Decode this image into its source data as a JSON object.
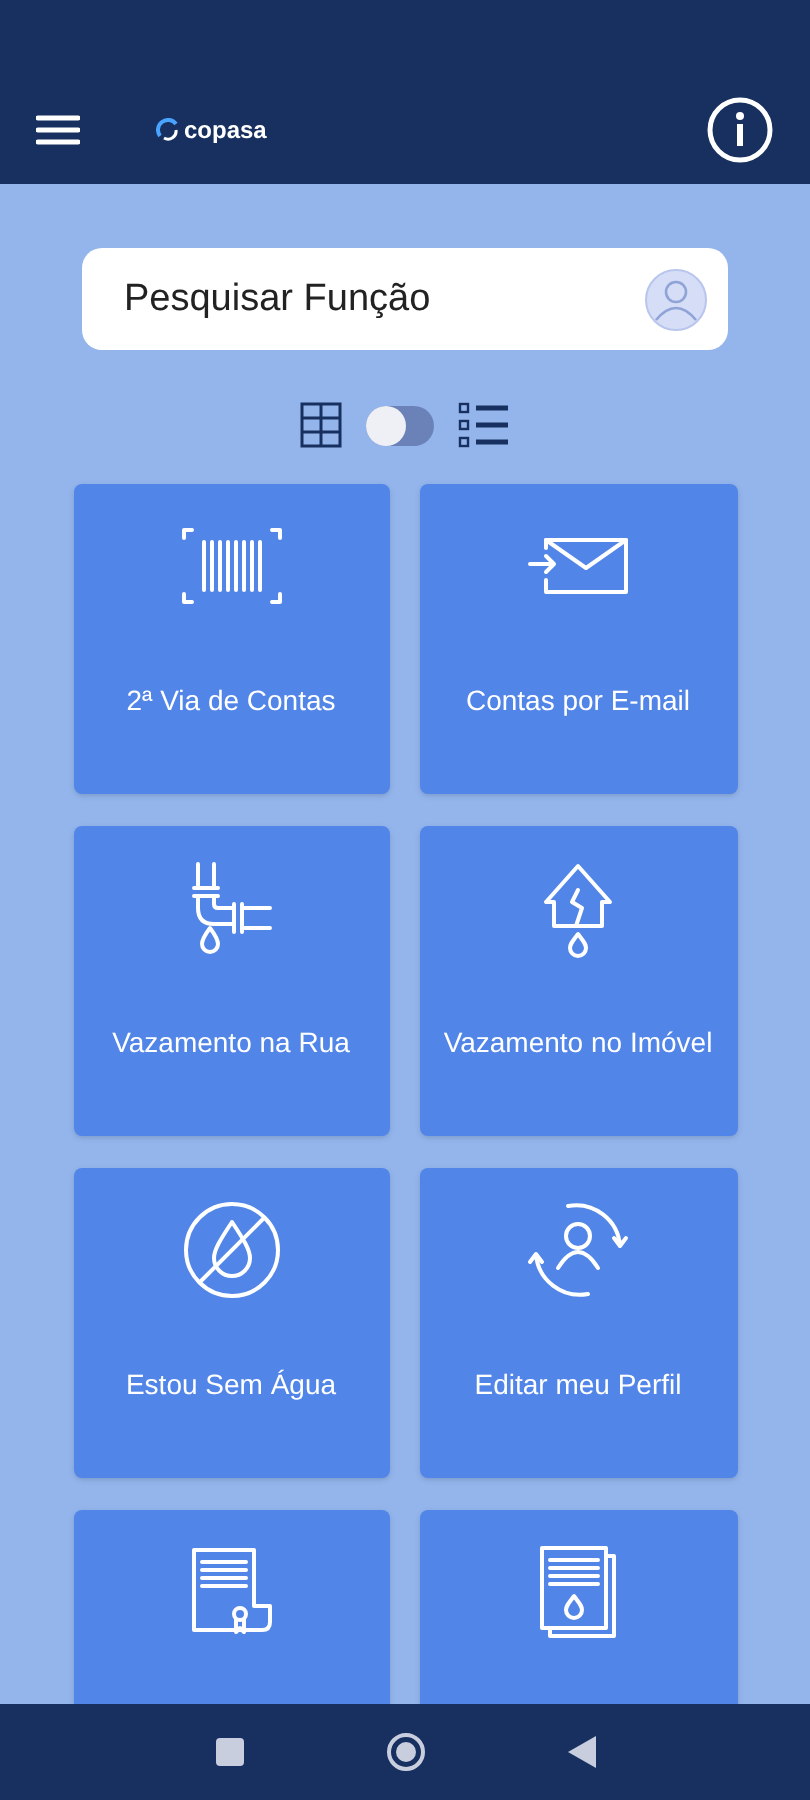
{
  "header": {
    "logo": "copasa"
  },
  "search": {
    "placeholder": "Pesquisar Função"
  },
  "view_toggle": {
    "on": false
  },
  "tiles": [
    {
      "kind": "barcode",
      "label": "2ª Via de Contas"
    },
    {
      "kind": "email",
      "label": "Contas por E-mail"
    },
    {
      "kind": "pipe-leak",
      "label": "Vazamento na Rua"
    },
    {
      "kind": "house-leak",
      "label": "Vazamento no Imóvel"
    },
    {
      "kind": "no-water",
      "label": "Estou Sem Água"
    },
    {
      "kind": "profile",
      "label": "Editar meu Perfil"
    },
    {
      "kind": "certificate"
    },
    {
      "kind": "document"
    }
  ]
}
